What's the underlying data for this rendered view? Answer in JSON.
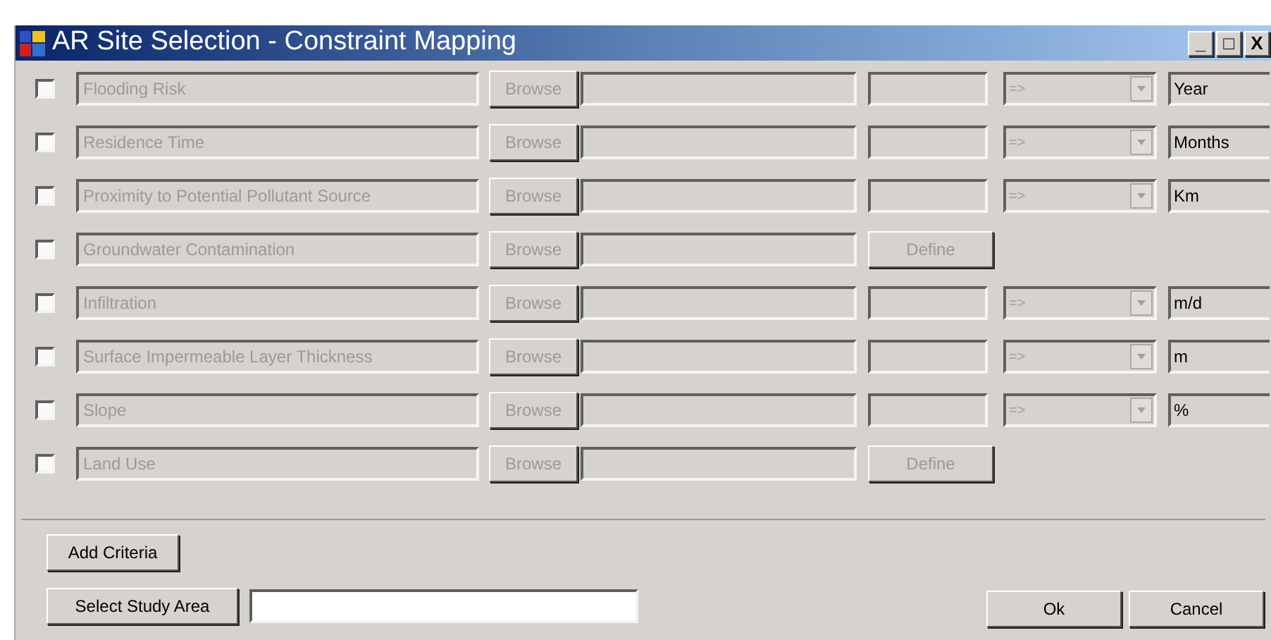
{
  "window": {
    "title": "AR Site Selection - Constraint Mapping",
    "controls": [
      "_",
      "□",
      "X"
    ]
  },
  "rows": [
    {
      "kind": "numeric",
      "checked": false,
      "name": "Flooding Risk",
      "browse": "Browse",
      "operator": "=>",
      "unit": "Year"
    },
    {
      "kind": "numeric",
      "checked": false,
      "name": "Residence Time",
      "browse": "Browse",
      "operator": "=>",
      "unit": "Months"
    },
    {
      "kind": "numeric",
      "checked": false,
      "name": "Proximity to Potential Pollutant Source",
      "browse": "Browse",
      "operator": "=>",
      "unit": "Km"
    },
    {
      "kind": "define",
      "checked": false,
      "name": "Groundwater Contamination",
      "browse": "Browse",
      "define": "Define"
    },
    {
      "kind": "numeric",
      "checked": false,
      "name": "Infiltration",
      "browse": "Browse",
      "operator": "=>",
      "unit": "m/d"
    },
    {
      "kind": "numeric",
      "checked": false,
      "name": "Surface Impermeable Layer Thickness",
      "browse": "Browse",
      "operator": "=>",
      "unit": "m"
    },
    {
      "kind": "numeric",
      "checked": false,
      "name": "Slope",
      "browse": "Browse",
      "operator": "=>",
      "unit": "%"
    },
    {
      "kind": "define",
      "checked": false,
      "name": "Land Use",
      "browse": "Browse",
      "define": "Define"
    }
  ],
  "add_criteria": "Add Criteria",
  "select_study_area": "Select Study Area",
  "ok": "Ok",
  "cancel": "Cancel"
}
